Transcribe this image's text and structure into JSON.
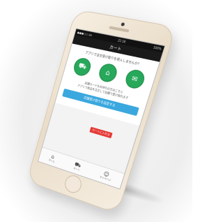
{
  "status_bar": {
    "carrier": "●●●○○ au",
    "time": "21:16",
    "battery": "100%"
  },
  "nav_bar": {
    "title": "カート"
  },
  "main": {
    "question": "アプリで注文受け取りを導入しませんか？",
    "steps": [
      {
        "icon": "cart-icon",
        "glyph": "⛟"
      },
      {
        "icon": "store-icon",
        "glyph": "⌂"
      },
      {
        "icon": "bag-icon",
        "glyph": "✉"
      }
    ],
    "description_line1": "店舗カードをお持ちの方はこちら",
    "description_line2": "アプリで商品を注文して店舗で受け取れます",
    "cta_label": "店舗受け取りを設定する"
  },
  "badge": {
    "label": "カートに入れる"
  },
  "tab_bar": {
    "items": [
      {
        "label": "ホーム",
        "icon": "home-icon",
        "glyph": "⌂"
      },
      {
        "label": "カート",
        "icon": "cart-icon",
        "glyph": "⛟"
      },
      {
        "label": "マイページ",
        "icon": "person-icon",
        "glyph": "☺"
      }
    ]
  },
  "colors": {
    "accent_green": "#27a85a",
    "accent_blue": "#3aa8de",
    "badge_red": "#e53935",
    "phone_gold": "#e9dcc8"
  }
}
